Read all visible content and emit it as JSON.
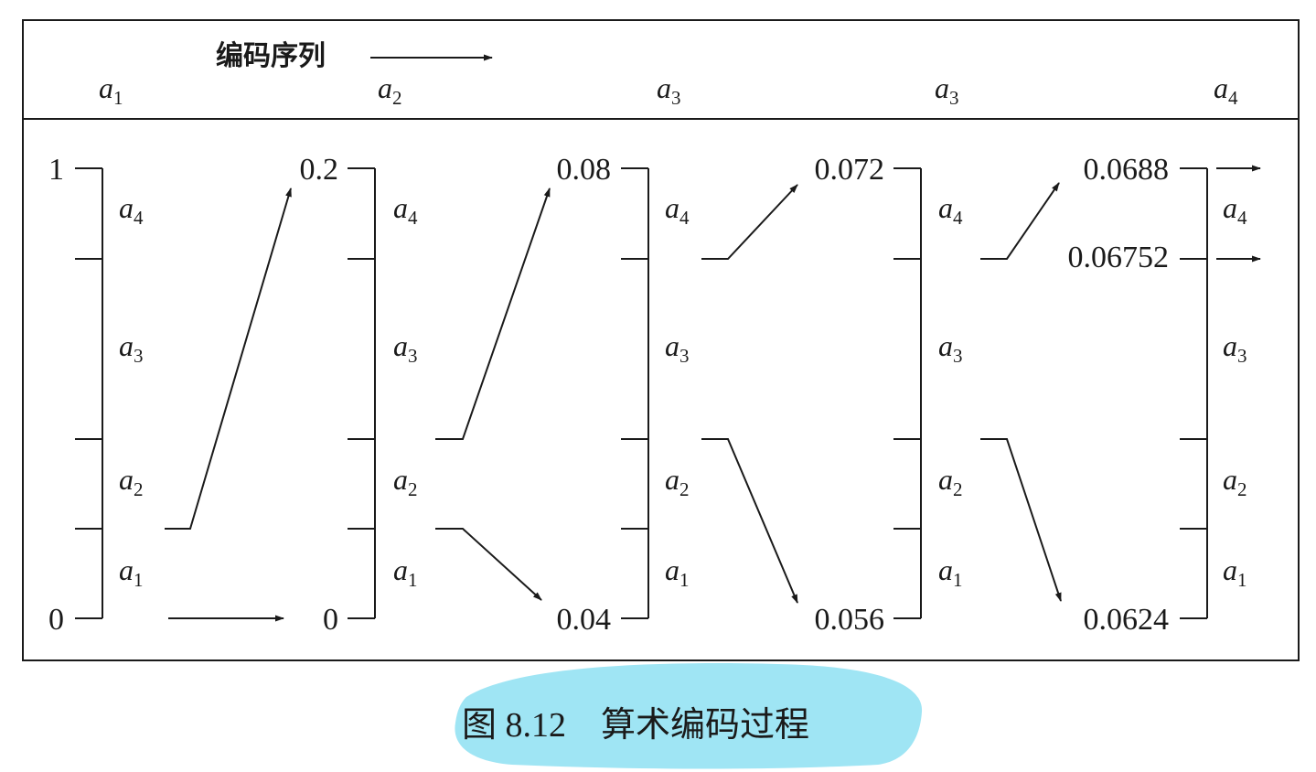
{
  "header": {
    "sequence_label": "编码序列",
    "sequence": [
      {
        "base": "a",
        "sub": "1"
      },
      {
        "base": "a",
        "sub": "2"
      },
      {
        "base": "a",
        "sub": "3"
      },
      {
        "base": "a",
        "sub": "3"
      },
      {
        "base": "a",
        "sub": "4"
      }
    ]
  },
  "stages": [
    {
      "top": "1",
      "bottom": "0",
      "inner_ticks": [],
      "symbols": [
        "a4",
        "a3",
        "a2",
        "a1"
      ]
    },
    {
      "top": "0.2",
      "bottom": "0",
      "inner_ticks": [],
      "symbols": [
        "a4",
        "a3",
        "a2",
        "a1"
      ]
    },
    {
      "top": "0.08",
      "bottom": "0.04",
      "inner_ticks": [],
      "symbols": [
        "a4",
        "a3",
        "a2",
        "a1"
      ]
    },
    {
      "top": "0.072",
      "bottom": "0.056",
      "inner_ticks": [],
      "symbols": [
        "a4",
        "a3",
        "a2",
        "a1"
      ]
    },
    {
      "top": "0.0688",
      "bottom": "0.0624",
      "inner_ticks": [
        "0.06752"
      ],
      "symbols": [
        "a4",
        "a3",
        "a2",
        "a1"
      ]
    }
  ],
  "symbol_intervals": {
    "a1": [
      0.0,
      0.2
    ],
    "a2": [
      0.2,
      0.4
    ],
    "a3": [
      0.4,
      0.8
    ],
    "a4": [
      0.8,
      1.0
    ]
  },
  "caption": "图 8.12　算术编码过程",
  "colors": {
    "ink": "#1a1a1a",
    "highlight": "#8ee0f2"
  }
}
